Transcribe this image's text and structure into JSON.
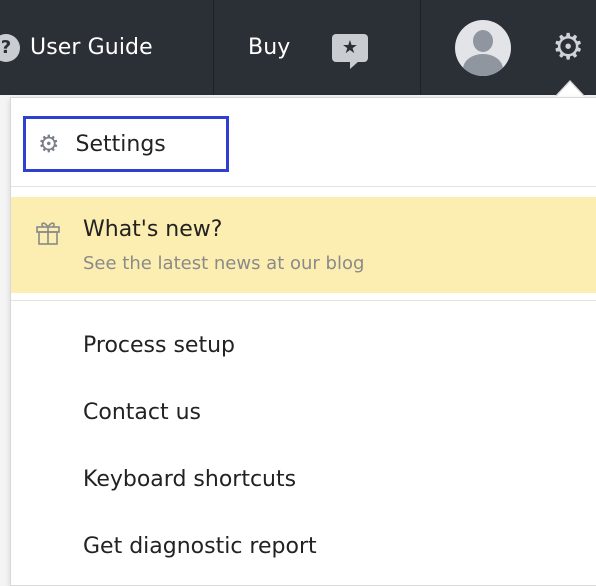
{
  "topbar": {
    "user_guide_label": "User Guide",
    "buy_label": "Buy",
    "help_icon": "?",
    "feedback_icon": "★",
    "settings_icon": "⚙"
  },
  "dropdown": {
    "settings_label": "Settings",
    "whats_new": {
      "title": "What's new?",
      "subtitle": "See the latest news at our blog"
    },
    "items": [
      "Process setup",
      "Contact us",
      "Keyboard shortcuts",
      "Get diagnostic report"
    ]
  },
  "colors": {
    "topbar_bg": "#2b2f36",
    "highlight_border": "#2f3fd1",
    "whats_new_bg": "#fbeeb0"
  }
}
